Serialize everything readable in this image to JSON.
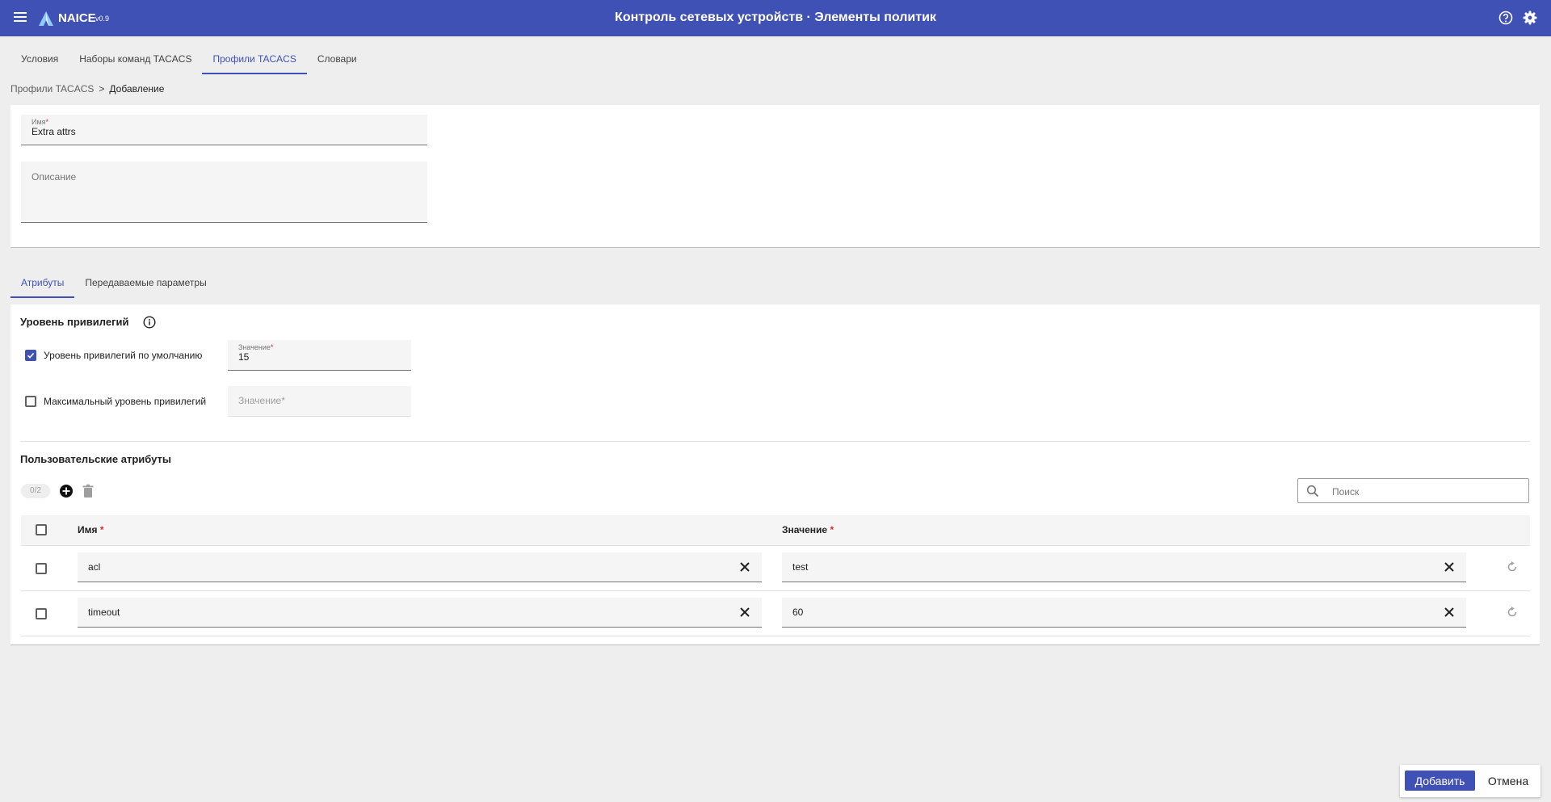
{
  "header": {
    "brand": "NAICE",
    "version": "v0.9",
    "title": "Контроль сетевых устройств · Элементы политик"
  },
  "top_tabs": [
    {
      "label": "Условия",
      "active": false
    },
    {
      "label": "Наборы команд TACACS",
      "active": false
    },
    {
      "label": "Профили TACACS",
      "active": true
    },
    {
      "label": "Словари",
      "active": false
    }
  ],
  "breadcrumb": {
    "parent": "Профили TACACS",
    "separator": ">",
    "current": "Добавление"
  },
  "form": {
    "name_label": "Имя",
    "name_required": "*",
    "name_value": "Extra attrs",
    "description_placeholder": "Описание"
  },
  "section_tabs": [
    {
      "label": "Атрибуты",
      "active": true
    },
    {
      "label": "Передаваемые параметры",
      "active": false
    }
  ],
  "privileges": {
    "title": "Уровень привилегий",
    "default_label": "Уровень привилегий по умолчанию",
    "default_checked": true,
    "default_value_label": "Значение",
    "default_value": "15",
    "max_label": "Максимальный уровень привилегий",
    "max_checked": false,
    "max_value_placeholder": "Значение*"
  },
  "custom_attrs": {
    "title": "Пользовательские атрибуты",
    "selected_count": "0/2",
    "search_placeholder": "Поиск",
    "columns": {
      "name": "Имя",
      "value": "Значение",
      "required": "*"
    },
    "rows": [
      {
        "name": "acl",
        "value": "test"
      },
      {
        "name": "timeout",
        "value": "60"
      }
    ]
  },
  "footer": {
    "add_label": "Добавить",
    "cancel_label": "Отмена"
  },
  "colors": {
    "primary": "#3f51b5",
    "required": "#d32f2f",
    "background": "#eeeeee"
  }
}
